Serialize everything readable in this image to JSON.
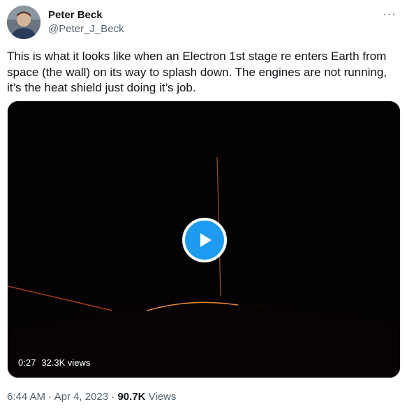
{
  "author": {
    "name": "Peter Beck",
    "handle": "@Peter_J_Beck",
    "avatar_icon": "person-avatar-icon"
  },
  "more_icon": "more-horizontal-icon",
  "more_label": "···",
  "tweet": {
    "text": "This is what it looks like when an Electron 1st stage re enters Earth from space (the wall) on its way to splash down. The engines are not running, it’s the heat shield just doing it’s job."
  },
  "video": {
    "duration": "0:27",
    "views": "32.3K views",
    "play_icon": "play-icon"
  },
  "footer": {
    "time": "6:44 AM",
    "separator1": "·",
    "date": "Apr 4, 2023",
    "separator2": "·",
    "views_count": "90.7K",
    "views_label": "Views"
  },
  "colors": {
    "accent": "#1d9bf0",
    "text_primary": "#0f1419",
    "text_secondary": "#536471"
  }
}
